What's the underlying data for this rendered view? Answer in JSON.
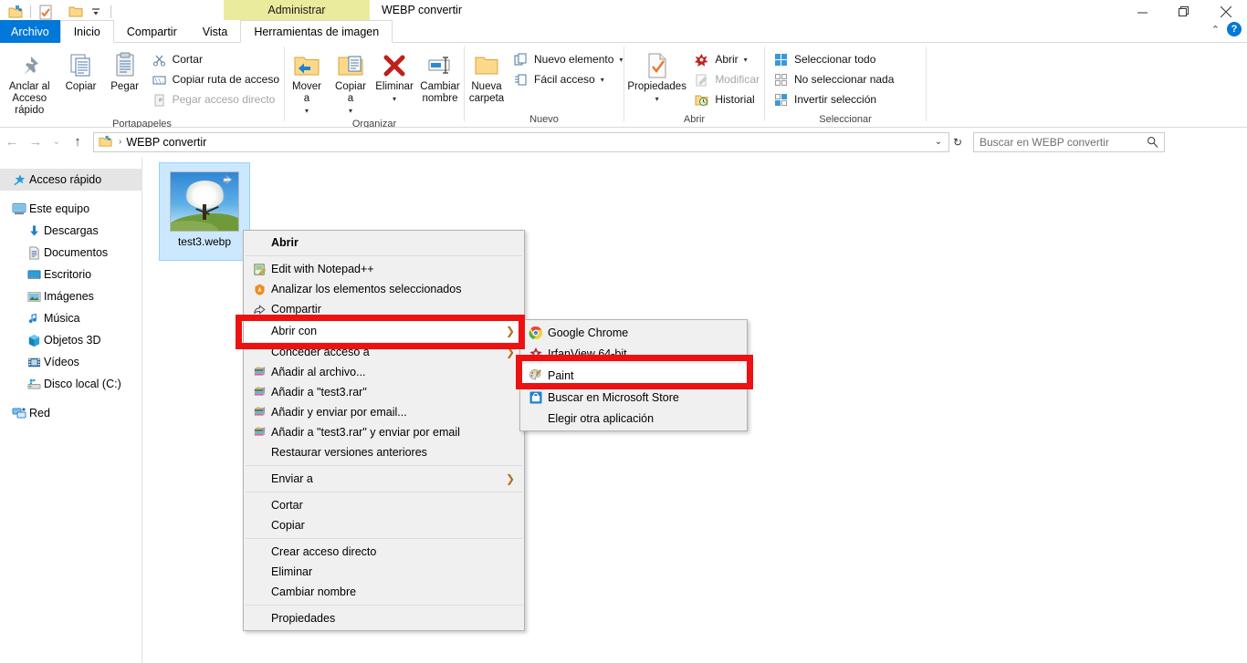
{
  "window": {
    "title": "WEBP convertir",
    "contextual_tab_header": "Administrar",
    "minimize": "–",
    "maximize": "❐",
    "close": "✕",
    "collapse_ribbon": "⌃",
    "help": "?"
  },
  "quick_access": {
    "items": [
      {
        "name": "new-folder-icon",
        "label": "Nueva carpeta"
      },
      {
        "name": "properties-icon",
        "label": "Propiedades"
      },
      {
        "name": "folder-icon",
        "label": "Carpeta"
      },
      {
        "name": "customize-dropdown-icon",
        "label": "Personalizar barra de herramientas de acceso rápido"
      }
    ]
  },
  "tabs": [
    {
      "id": "archivo",
      "label": "Archivo",
      "state": "file"
    },
    {
      "id": "inicio",
      "label": "Inicio",
      "state": "active"
    },
    {
      "id": "compartir",
      "label": "Compartir",
      "state": "normal"
    },
    {
      "id": "vista",
      "label": "Vista",
      "state": "normal"
    },
    {
      "id": "herramientas",
      "label": "Herramientas de imagen",
      "state": "contextual"
    }
  ],
  "ribbon": {
    "groups": [
      {
        "label": "Portapapeles",
        "big_buttons": [
          {
            "name": "pin-to-quick-access-button",
            "label": "Anclar al\nAcceso rápido",
            "icon": "pin-icon"
          },
          {
            "name": "copy-button",
            "label": "Copiar",
            "icon": "copy-icon"
          },
          {
            "name": "paste-button",
            "label": "Pegar",
            "icon": "paste-icon"
          }
        ],
        "small_buttons": [
          {
            "name": "cut-button",
            "label": "Cortar",
            "icon": "scissors-icon",
            "disabled": false
          },
          {
            "name": "copy-path-button",
            "label": "Copiar ruta de acceso",
            "icon": "copy-path-icon",
            "disabled": false
          },
          {
            "name": "paste-shortcut-button",
            "label": "Pegar acceso directo",
            "icon": "paste-shortcut-icon",
            "disabled": true
          }
        ]
      },
      {
        "label": "Organizar",
        "big_buttons": [
          {
            "name": "move-to-button",
            "label": "Mover\na",
            "icon": "move-to-icon",
            "has_caret": true
          },
          {
            "name": "copy-to-button",
            "label": "Copiar\na",
            "icon": "copy-to-icon",
            "has_caret": true
          },
          {
            "name": "delete-button",
            "label": "Eliminar",
            "icon": "delete-x-icon",
            "has_caret": true
          },
          {
            "name": "rename-button",
            "label": "Cambiar\nnombre",
            "icon": "rename-icon",
            "has_caret": false
          }
        ],
        "small_buttons": []
      },
      {
        "label": "Nuevo",
        "big_buttons": [
          {
            "name": "new-folder-button",
            "label": "Nueva\ncarpeta",
            "icon": "folder-icon",
            "has_caret": false
          }
        ],
        "small_buttons": [
          {
            "name": "new-item-button",
            "label": "Nuevo elemento",
            "icon": "new-item-icon",
            "has_caret": true
          },
          {
            "name": "easy-access-button",
            "label": "Fácil acceso",
            "icon": "easy-access-icon",
            "has_caret": true
          }
        ]
      },
      {
        "label": "Abrir",
        "big_buttons": [
          {
            "name": "properties-button",
            "label": "Propiedades",
            "icon": "properties-icon",
            "has_caret": true
          }
        ],
        "small_buttons": [
          {
            "name": "open-button",
            "label": "Abrir",
            "icon": "open-irfanview-icon",
            "has_caret": true,
            "disabled": false
          },
          {
            "name": "edit-button",
            "label": "Modificar",
            "icon": "edit-icon",
            "disabled": true
          },
          {
            "name": "history-button",
            "label": "Historial",
            "icon": "history-icon",
            "disabled": false
          }
        ]
      },
      {
        "label": "Seleccionar",
        "big_buttons": [],
        "small_buttons": [
          {
            "name": "select-all-button",
            "label": "Seleccionar todo",
            "icon": "select-all-icon",
            "disabled": false
          },
          {
            "name": "select-none-button",
            "label": "No seleccionar nada",
            "icon": "select-none-icon",
            "disabled": false
          },
          {
            "name": "invert-selection-button",
            "label": "Invertir selección",
            "icon": "invert-selection-icon",
            "disabled": false
          }
        ]
      }
    ]
  },
  "addressbar": {
    "back": "←",
    "forward": "→",
    "recent": "⌄",
    "up": "↑",
    "breadcrumb_icon": "folder-icon",
    "separator": "›",
    "path": "WEBP convertir",
    "dropdown": "⌄",
    "refresh": "↻"
  },
  "search": {
    "placeholder": "Buscar en WEBP convertir",
    "icon": "search-icon"
  },
  "navpane": {
    "items": [
      {
        "label": "Acceso rápido",
        "icon": "star-pin-icon",
        "level": 0,
        "selected": true
      },
      {
        "label": "Este equipo",
        "icon": "this-pc-icon",
        "level": 0,
        "selected": false
      },
      {
        "label": "Descargas",
        "icon": "downloads-icon",
        "level": 1,
        "selected": false
      },
      {
        "label": "Documentos",
        "icon": "documents-icon",
        "level": 1,
        "selected": false
      },
      {
        "label": "Escritorio",
        "icon": "desktop-icon",
        "level": 1,
        "selected": false
      },
      {
        "label": "Imágenes",
        "icon": "pictures-icon",
        "level": 1,
        "selected": false
      },
      {
        "label": "Música",
        "icon": "music-icon",
        "level": 1,
        "selected": false
      },
      {
        "label": "Objetos 3D",
        "icon": "objects3d-icon",
        "level": 1,
        "selected": false
      },
      {
        "label": "Vídeos",
        "icon": "videos-icon",
        "level": 1,
        "selected": false
      },
      {
        "label": "Disco local (C:)",
        "icon": "disk-icon",
        "level": 1,
        "selected": false
      },
      {
        "label": "Red",
        "icon": "network-icon",
        "level": 0,
        "selected": false
      }
    ]
  },
  "files": [
    {
      "name": "test3.webp",
      "selected": true,
      "icon": "image-thumbnail",
      "has_shortcut_overlay": true
    }
  ],
  "context_menu": {
    "items": [
      {
        "label": "Abrir",
        "icon": null,
        "bold": true,
        "submenu": false,
        "sep_after": true
      },
      {
        "label": "Edit with Notepad++",
        "icon": "notepadpp-icon",
        "bold": false,
        "submenu": false
      },
      {
        "label": "Analizar los elementos seleccionados",
        "icon": "avast-icon",
        "bold": false,
        "submenu": false
      },
      {
        "label": "Compartir",
        "icon": "share-icon",
        "bold": false,
        "submenu": false
      },
      {
        "label": "Abrir con",
        "icon": null,
        "bold": false,
        "submenu": true,
        "highlighted": true
      },
      {
        "label": "Conceder acceso a",
        "icon": null,
        "bold": false,
        "submenu": true
      },
      {
        "label": "Añadir al archivo...",
        "icon": "winrar-icon",
        "bold": false,
        "submenu": false
      },
      {
        "label": "Añadir a \"test3.rar\"",
        "icon": "winrar-icon",
        "bold": false,
        "submenu": false
      },
      {
        "label": "Añadir y enviar por email...",
        "icon": "winrar-icon",
        "bold": false,
        "submenu": false
      },
      {
        "label": "Añadir a \"test3.rar\" y enviar por email",
        "icon": "winrar-icon",
        "bold": false,
        "submenu": false
      },
      {
        "label": "Restaurar versiones anteriores",
        "icon": null,
        "bold": false,
        "submenu": false,
        "sep_after": true
      },
      {
        "label": "Enviar a",
        "icon": null,
        "bold": false,
        "submenu": true,
        "sep_after": true
      },
      {
        "label": "Cortar",
        "icon": null,
        "bold": false,
        "submenu": false
      },
      {
        "label": "Copiar",
        "icon": null,
        "bold": false,
        "submenu": false,
        "sep_after": true
      },
      {
        "label": "Crear acceso directo",
        "icon": null,
        "bold": false,
        "submenu": false
      },
      {
        "label": "Eliminar",
        "icon": null,
        "bold": false,
        "submenu": false
      },
      {
        "label": "Cambiar nombre",
        "icon": null,
        "bold": false,
        "submenu": false,
        "sep_after": true
      },
      {
        "label": "Propiedades",
        "icon": null,
        "bold": false,
        "submenu": false
      }
    ]
  },
  "submenu": {
    "items": [
      {
        "label": "Google Chrome",
        "icon": "chrome-icon"
      },
      {
        "label": "IrfanView 64-bit",
        "icon": "irfanview-icon"
      },
      {
        "label": "Paint",
        "icon": "paint-icon",
        "highlighted": true
      },
      {
        "label": "Buscar en Microsoft Store",
        "icon": "microsoft-store-icon"
      },
      {
        "label": "Elegir otra aplicación",
        "icon": null
      }
    ]
  },
  "annotations": {
    "highlight_color": "#ee1111",
    "boxes": [
      {
        "name": "abrir-con-highlight",
        "target": "Abrir con"
      },
      {
        "name": "paint-highlight",
        "target": "Paint"
      }
    ]
  }
}
